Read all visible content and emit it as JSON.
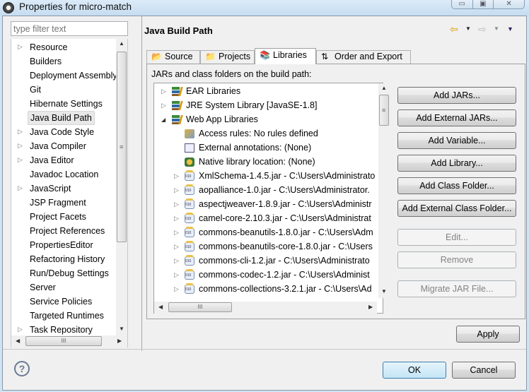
{
  "window": {
    "title": "Properties for micro-match",
    "minimize_glyph": "▭",
    "maximize_glyph": "▣",
    "close_glyph": "✕"
  },
  "sidebar": {
    "filter_placeholder": "type filter text",
    "items": [
      {
        "label": "Resource",
        "expandable": true
      },
      {
        "label": "Builders",
        "expandable": false
      },
      {
        "label": "Deployment Assembly",
        "expandable": false
      },
      {
        "label": "Git",
        "expandable": false
      },
      {
        "label": "Hibernate Settings",
        "expandable": false
      },
      {
        "label": "Java Build Path",
        "expandable": false,
        "selected": true
      },
      {
        "label": "Java Code Style",
        "expandable": true
      },
      {
        "label": "Java Compiler",
        "expandable": true
      },
      {
        "label": "Java Editor",
        "expandable": true
      },
      {
        "label": "Javadoc Location",
        "expandable": false
      },
      {
        "label": "JavaScript",
        "expandable": true
      },
      {
        "label": "JSP Fragment",
        "expandable": false
      },
      {
        "label": "Project Facets",
        "expandable": false
      },
      {
        "label": "Project References",
        "expandable": false
      },
      {
        "label": "PropertiesEditor",
        "expandable": false
      },
      {
        "label": "Refactoring History",
        "expandable": false
      },
      {
        "label": "Run/Debug Settings",
        "expandable": false
      },
      {
        "label": "Server",
        "expandable": false
      },
      {
        "label": "Service Policies",
        "expandable": false
      },
      {
        "label": "Targeted Runtimes",
        "expandable": false
      },
      {
        "label": "Task Repository",
        "expandable": true
      }
    ]
  },
  "page": {
    "title": "Java Build Path",
    "back_glyph": "⇦",
    "forward_glyph": "⇨",
    "dropdown_glyph": "▼"
  },
  "tabs": [
    {
      "label": "Source",
      "icon": "source-folder-icon",
      "glyph": "📂"
    },
    {
      "label": "Projects",
      "icon": "project-folder-icon",
      "glyph": "📁"
    },
    {
      "label": "Libraries",
      "icon": "libraries-icon",
      "glyph": "📚",
      "active": true
    },
    {
      "label": "Order and Export",
      "icon": "order-export-icon",
      "glyph": "⇅"
    }
  ],
  "libraries": {
    "caption": "JARs and class folders on the build path:",
    "tree": [
      {
        "label": "EAR Libraries",
        "type": "library",
        "level": 0,
        "state": "collapsed"
      },
      {
        "label": "JRE System Library [JavaSE-1.8]",
        "type": "library",
        "level": 0,
        "state": "collapsed"
      },
      {
        "label": "Web App Libraries",
        "type": "library",
        "level": 0,
        "state": "expanded"
      },
      {
        "label": "Access rules: No rules defined",
        "type": "access-rules",
        "level": 1,
        "state": "leaf"
      },
      {
        "label": "External annotations: (None)",
        "type": "annotations",
        "level": 1,
        "state": "leaf"
      },
      {
        "label": "Native library location: (None)",
        "type": "native",
        "level": 1,
        "state": "leaf"
      },
      {
        "label": "XmlSchema-1.4.5.jar - C:\\Users\\Administrato",
        "type": "jar",
        "level": 1,
        "state": "collapsed"
      },
      {
        "label": "aopalliance-1.0.jar - C:\\Users\\Administrator.",
        "type": "jar",
        "level": 1,
        "state": "collapsed"
      },
      {
        "label": "aspectjweaver-1.8.9.jar - C:\\Users\\Administr",
        "type": "jar",
        "level": 1,
        "state": "collapsed"
      },
      {
        "label": "camel-core-2.10.3.jar - C:\\Users\\Administrat",
        "type": "jar",
        "level": 1,
        "state": "collapsed"
      },
      {
        "label": "commons-beanutils-1.8.0.jar - C:\\Users\\Adm",
        "type": "jar",
        "level": 1,
        "state": "collapsed"
      },
      {
        "label": "commons-beanutils-core-1.8.0.jar - C:\\Users",
        "type": "jar",
        "level": 1,
        "state": "collapsed"
      },
      {
        "label": "commons-cli-1.2.jar - C:\\Users\\Administrato",
        "type": "jar",
        "level": 1,
        "state": "collapsed"
      },
      {
        "label": "commons-codec-1.2.jar - C:\\Users\\Administ",
        "type": "jar",
        "level": 1,
        "state": "collapsed"
      },
      {
        "label": "commons-collections-3.2.1.jar - C:\\Users\\Ad",
        "type": "jar",
        "level": 1,
        "state": "collapsed"
      }
    ],
    "buttons": [
      {
        "label": "Add JARs...",
        "enabled": true
      },
      {
        "label": "Add External JARs...",
        "enabled": true
      },
      {
        "label": "Add Variable...",
        "enabled": true
      },
      {
        "label": "Add Library...",
        "enabled": true
      },
      {
        "label": "Add Class Folder...",
        "enabled": true
      },
      {
        "label": "Add External Class Folder...",
        "enabled": true
      },
      {
        "label": "Edit...",
        "enabled": false
      },
      {
        "label": "Remove",
        "enabled": false
      },
      {
        "label": "Migrate JAR File...",
        "enabled": false
      }
    ]
  },
  "footer": {
    "apply": "Apply",
    "ok": "OK",
    "cancel": "Cancel",
    "help_glyph": "?"
  }
}
